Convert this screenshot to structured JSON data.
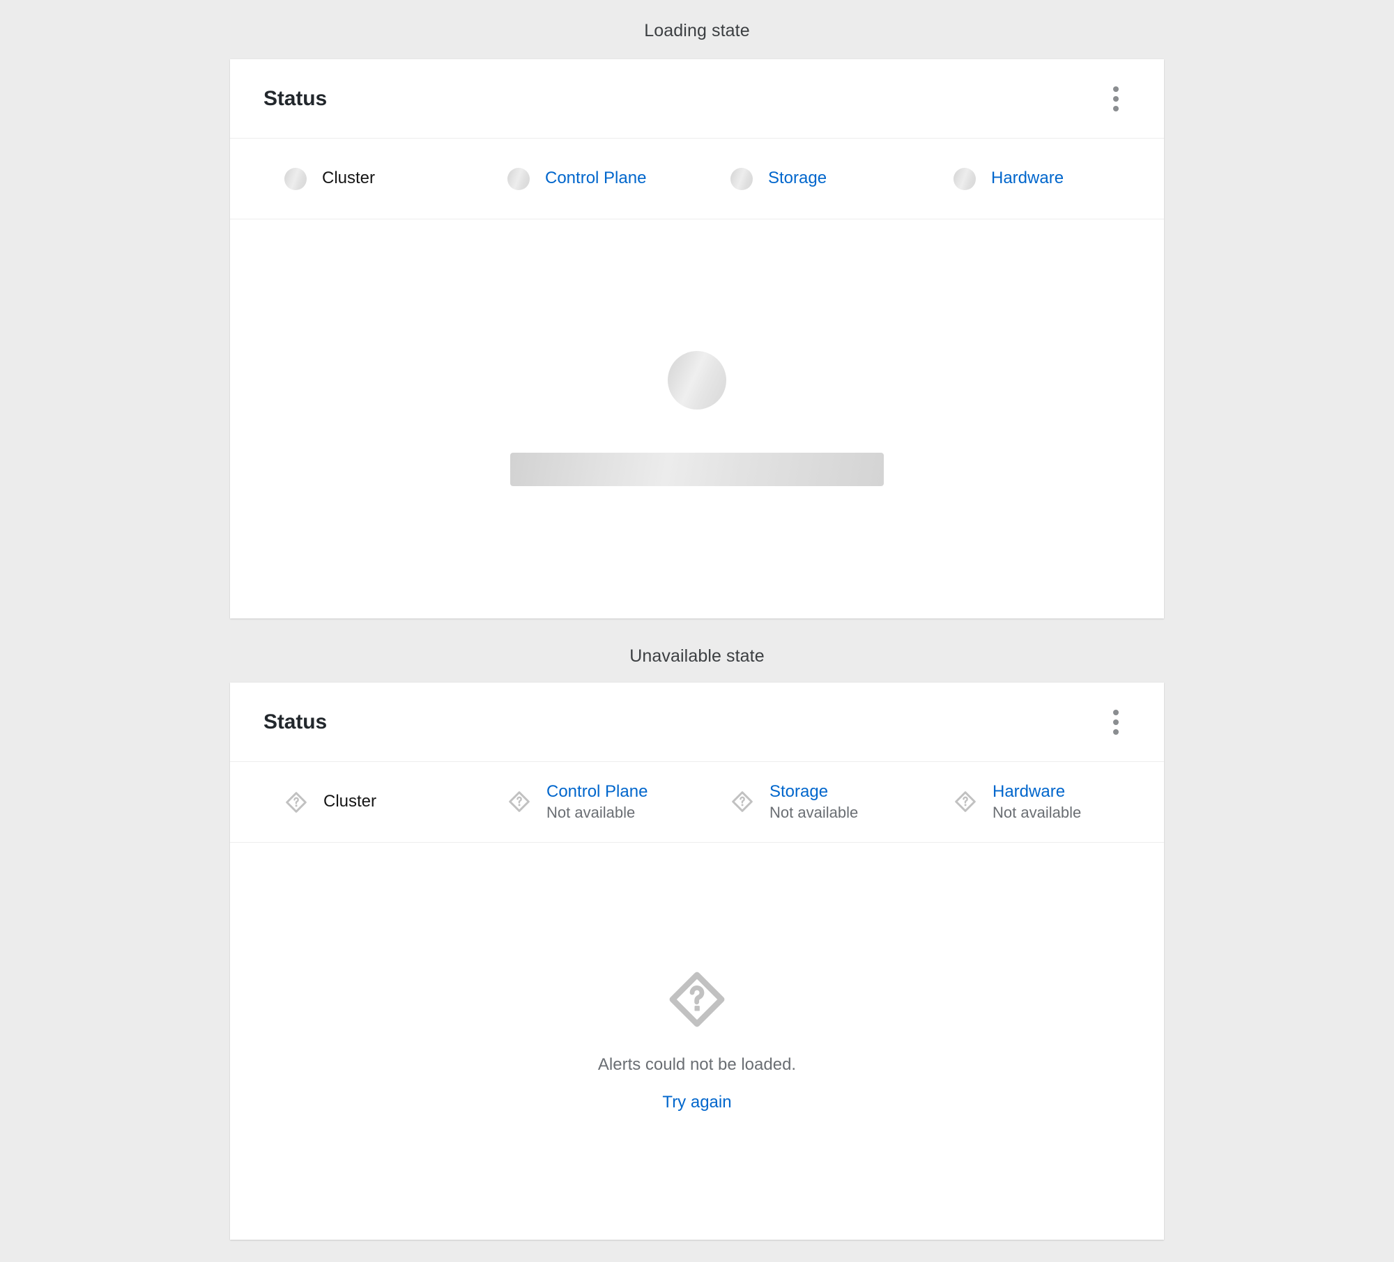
{
  "sections": [
    {
      "title": "Loading state"
    },
    {
      "title": "Unavailable state"
    }
  ],
  "colors": {
    "page_background": "#ececec",
    "card_background": "#ffffff",
    "link_blue": "#0066cc",
    "text_primary": "#151515",
    "text_secondary": "#6a6e73",
    "title_dark": "#22272c",
    "divider": "#ededed",
    "icon_gray": "#c1c1c1",
    "kebab_gray": "#8a8d90"
  },
  "loading_card": {
    "title": "Status",
    "kebab_icon": "kebab-menu-icon",
    "status_items": [
      {
        "label": "Cluster",
        "is_link": false,
        "icon": "skeleton-circle-icon"
      },
      {
        "label": "Control Plane",
        "is_link": true,
        "icon": "skeleton-circle-icon"
      },
      {
        "label": "Storage",
        "is_link": true,
        "icon": "skeleton-circle-icon"
      },
      {
        "label": "Hardware",
        "is_link": true,
        "icon": "skeleton-circle-icon"
      }
    ],
    "body": {
      "skeleton_circle_icon": "skeleton-circle-placeholder",
      "skeleton_bar_icon": "skeleton-bar-placeholder"
    }
  },
  "unavailable_card": {
    "title": "Status",
    "kebab_icon": "kebab-menu-icon",
    "status_items": [
      {
        "label": "Cluster",
        "is_link": false,
        "sub": "",
        "icon": "unknown-diamond-icon"
      },
      {
        "label": "Control Plane",
        "is_link": true,
        "sub": "Not available",
        "icon": "unknown-diamond-icon"
      },
      {
        "label": "Storage",
        "is_link": true,
        "sub": "Not available",
        "icon": "unknown-diamond-icon"
      },
      {
        "label": "Hardware",
        "is_link": true,
        "sub": "Not available",
        "icon": "unknown-diamond-icon"
      }
    ],
    "body": {
      "icon": "unknown-diamond-icon",
      "message": "Alerts could not be loaded.",
      "action_label": "Try again"
    }
  }
}
